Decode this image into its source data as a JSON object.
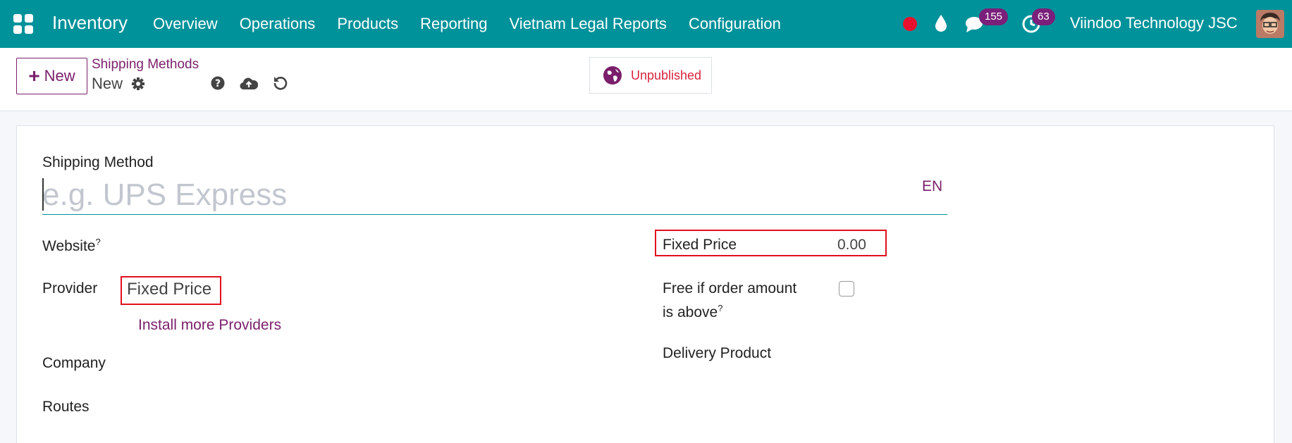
{
  "navbar": {
    "app_name": "Inventory",
    "menu": [
      "Overview",
      "Operations",
      "Products",
      "Reporting",
      "Vietnam Legal Reports",
      "Configuration"
    ],
    "chat_count": "155",
    "activity_count": "63",
    "company": "Viindoo Technology JSC",
    "color": "#00929a"
  },
  "control": {
    "new_label": "New",
    "breadcrumb_parent": "Shipping Methods",
    "record_name": "New",
    "publish_status": "Unpublished"
  },
  "form": {
    "shipping_method_label": "Shipping Method",
    "shipping_method_placeholder": "e.g. UPS Express",
    "language": "EN",
    "website_label": "Website",
    "website_help": "?",
    "provider_label": "Provider",
    "provider_value": "Fixed Price",
    "install_providers": "Install more Providers",
    "company_label": "Company",
    "routes_label": "Routes",
    "fixed_price_label": "Fixed Price",
    "fixed_price_value": "0.00",
    "free_if_label_1": "Free if order amount",
    "free_if_label_2": "is above",
    "free_if_help": "?",
    "delivery_product_label": "Delivery Product"
  },
  "colors": {
    "accent": "#7a1f6b",
    "highlight": "#e0101e"
  }
}
